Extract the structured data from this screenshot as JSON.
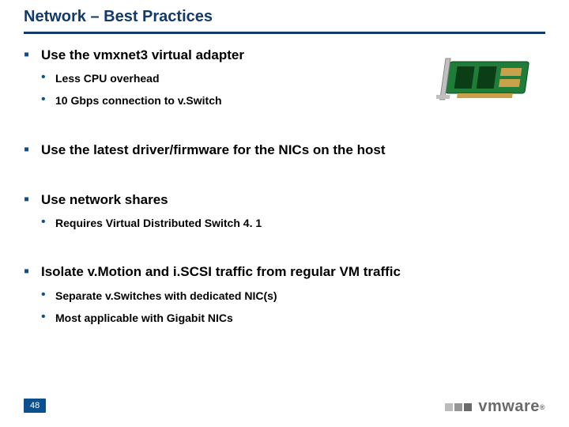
{
  "page": {
    "title": "Network – Best Practices",
    "number": "48"
  },
  "logo": {
    "text": "vmware",
    "mark": "®"
  },
  "image": {
    "alt": "network-card"
  },
  "bullets": [
    {
      "text": "Use the vmxnet3 virtual adapter",
      "sub": [
        {
          "text": "Less CPU overhead"
        },
        {
          "text": "10 Gbps connection to v.Switch"
        }
      ]
    },
    {
      "text": "Use the latest driver/firmware for the NICs on the host",
      "sub": []
    },
    {
      "text": "Use network shares",
      "sub": [
        {
          "text": "Requires Virtual Distributed Switch 4. 1"
        }
      ]
    },
    {
      "text": "Isolate v.Motion and i.SCSI traffic from regular VM traffic",
      "sub": [
        {
          "text": "Separate v.Switches with dedicated NIC(s)"
        },
        {
          "text": "Most applicable with Gigabit NICs"
        }
      ]
    }
  ]
}
